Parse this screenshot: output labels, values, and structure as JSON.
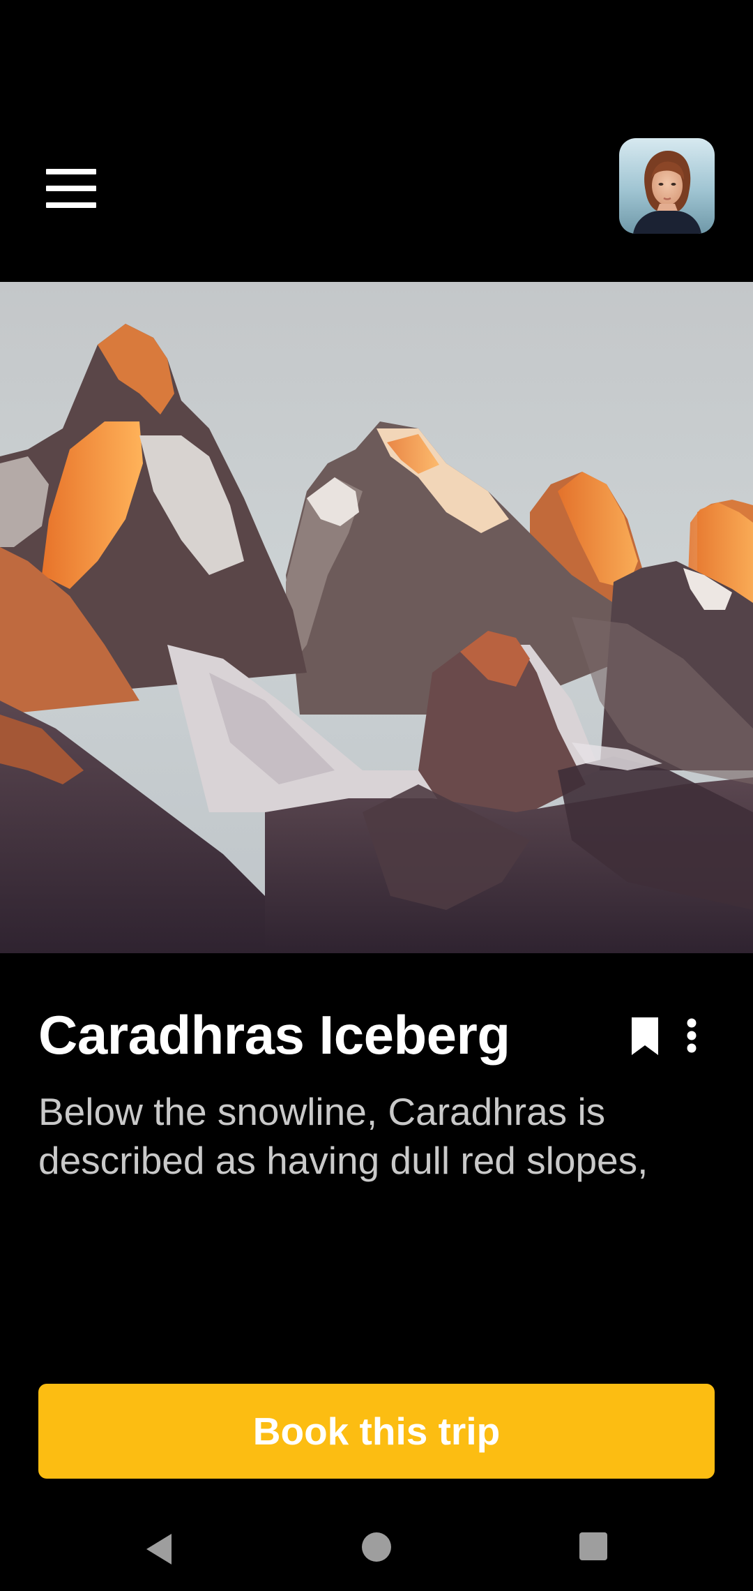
{
  "header": {
    "menu_icon": "hamburger-menu-icon",
    "avatar": "profile-avatar"
  },
  "hero": {
    "image": "mountain-peaks-photo"
  },
  "trip": {
    "title": "Caradhras Iceberg",
    "description": "Below the snowline, Caradhras is described as having dull red slopes,",
    "bookmark_icon": "bookmark-icon",
    "more_icon": "more-vertical-icon"
  },
  "cta": {
    "label": "Book this trip",
    "color": "#fcbd12"
  },
  "system_nav": {
    "back_icon": "back-triangle-icon",
    "home_icon": "home-circle-icon",
    "recents_icon": "recents-square-icon"
  }
}
